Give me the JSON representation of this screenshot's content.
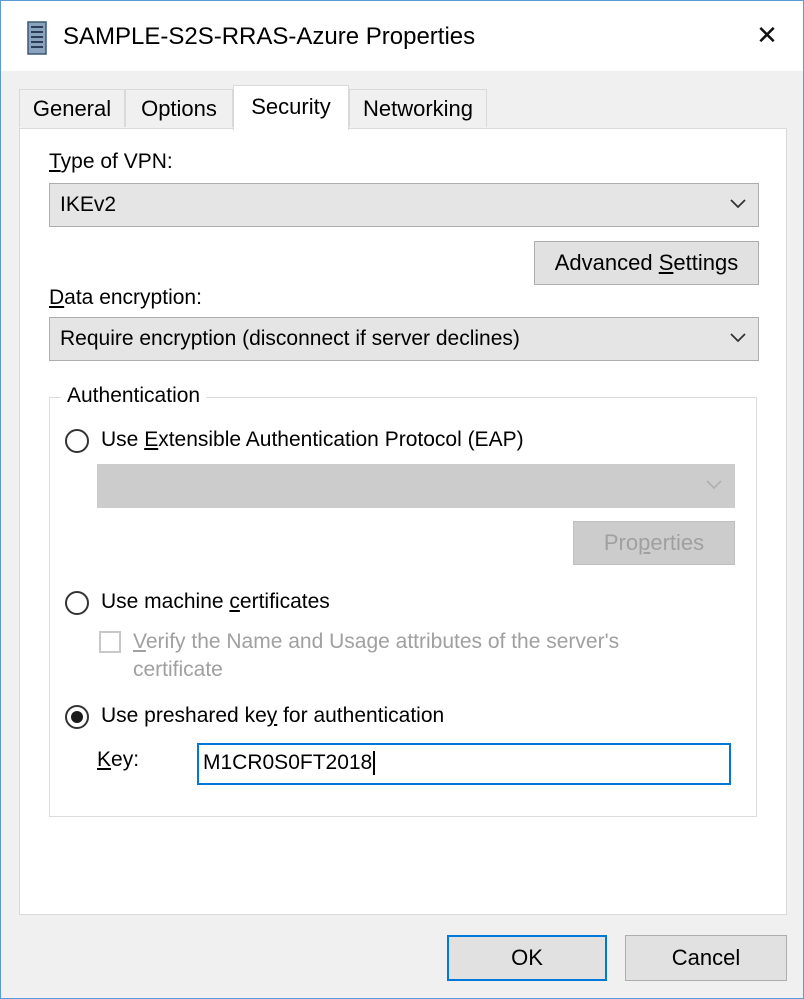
{
  "window": {
    "title": "SAMPLE-S2S-RRAS-Azure Properties",
    "close_glyph": "✕"
  },
  "tabs": [
    {
      "label": "General"
    },
    {
      "label": "Options"
    },
    {
      "label": "Security",
      "active": true
    },
    {
      "label": "Networking"
    }
  ],
  "security": {
    "vpn_type_label_mnemonic": "T",
    "vpn_type_label_rest": "ype of VPN:",
    "vpn_type_value": "IKEv2",
    "advanced_settings_pre": "Advanced ",
    "advanced_settings_mnemonic": "S",
    "advanced_settings_post": "ettings",
    "data_encryption_label_mnemonic": "D",
    "data_encryption_label_rest": "ata encryption:",
    "data_encryption_value": "Require encryption (disconnect if server declines)"
  },
  "authentication": {
    "group_title": "Authentication",
    "eap_option_pre": "Use ",
    "eap_option_mnemonic": "E",
    "eap_option_post": "xtensible Authentication Protocol (EAP)",
    "eap_selected": false,
    "eap_method_value": "",
    "properties_pre": "Pro",
    "properties_mnemonic": "p",
    "properties_post": "erties",
    "machine_cert_pre": "Use machine ",
    "machine_cert_mnemonic": "c",
    "machine_cert_post": "ertificates",
    "machine_cert_selected": false,
    "verify_line1_mnemonic": "V",
    "verify_line1_rest": "erify the Name and Usage attributes of the server's",
    "verify_line2": "certificate",
    "verify_checked": false,
    "psk_option_pre": "Use preshared ke",
    "psk_option_mnemonic": "y",
    "psk_option_post": " for authentication",
    "psk_selected": true,
    "key_label_mnemonic": "K",
    "key_label_rest": "ey:",
    "key_value": "M1CR0S0FT2018"
  },
  "footer": {
    "ok_label": "OK",
    "cancel_label": "Cancel"
  },
  "colors": {
    "accent": "#0078d7",
    "window_border": "#5a9ad6"
  },
  "icons": {
    "app": "server-icon",
    "close": "close-icon",
    "dropdown": "chevron-down-icon"
  }
}
